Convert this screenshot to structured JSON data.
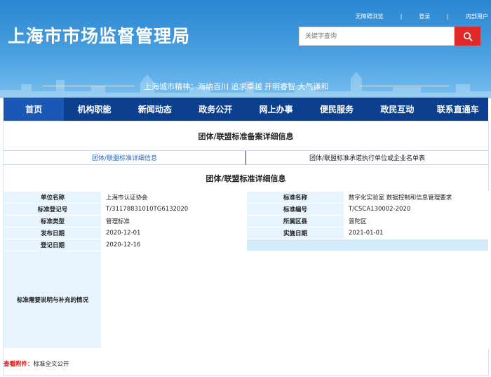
{
  "top_links": {
    "accessibility": "无障碍浏览",
    "login": "登录",
    "intranet": "内部用户",
    "separator": "|"
  },
  "site": {
    "title": "上海市市场监督管理局"
  },
  "search": {
    "placeholder": "关键字查询"
  },
  "slogan": "上海城市精神：海纳百川  追求卓越  开明睿智  大气谦和",
  "nav": [
    {
      "label": "首页"
    },
    {
      "label": "机构职能"
    },
    {
      "label": "新闻动态"
    },
    {
      "label": "政务公开"
    },
    {
      "label": "网上办事"
    },
    {
      "label": "便民服务"
    },
    {
      "label": "政民互动"
    },
    {
      "label": "联系直通车"
    }
  ],
  "page": {
    "heading": "团体/联盟标准备案详细信息",
    "tabs": [
      {
        "label": "团体/联盟标准详细信息"
      },
      {
        "label": "团体/联盟标准承诺执行单位或企业名单表"
      }
    ],
    "sub_heading": "团体/联盟标准详细信息"
  },
  "info": {
    "unit_name_label": "单位名称",
    "unit_name": "上海市认证协会",
    "std_name_label": "标准名称",
    "std_name": "数字化实验室 数据控制和信息管理要求",
    "reg_no_label": "标准登记号",
    "reg_no": "T/31178831010TG6132020",
    "std_no_label": "标准编号",
    "std_no": "T/CSCA130002-2020",
    "std_type_label": "标准类型",
    "std_type": "管理标准",
    "district_label": "所属区县",
    "district": "普陀区",
    "publish_label": "发布日期",
    "publish": "2020-12-01",
    "impl_label": "实施日期",
    "impl": "2021-01-01",
    "reg_date_label": "登记日期",
    "reg_date": "2020-12-16",
    "memo_label": "标准需要说明与补充的情况"
  },
  "attachment": {
    "label": "查看附件",
    "colon": "：",
    "value": "标准全文公开"
  },
  "colors": {
    "nav_bg": "#0d3f8f",
    "nav_active": "#1b57b4",
    "search_btn": "#e02a2a",
    "label_bg": "#e7f3fd",
    "attach_key": "#e00000"
  }
}
